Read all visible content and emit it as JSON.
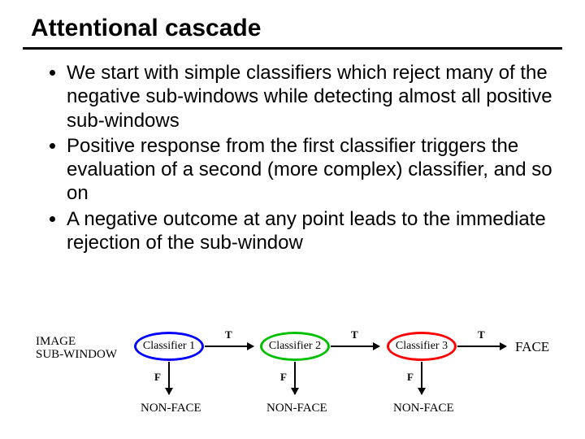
{
  "title": "Attentional cascade",
  "bullets": [
    "We start with simple classifiers which reject many of the negative sub-windows while detecting almost all positive sub-windows",
    "Positive response from the first classifier triggers the evaluation of a second (more complex) classifier, and so on",
    "A negative outcome at any point leads to the immediate rejection of the sub-window"
  ],
  "diagram": {
    "input_line1": "IMAGE",
    "input_line2": "SUB-WINDOW",
    "nodes": [
      "Classifier 1",
      "Classifier 2",
      "Classifier 3"
    ],
    "true_label": "T",
    "false_label": "F",
    "reject_label": "NON-FACE",
    "output_label": "FACE",
    "colors": [
      "#0000ff",
      "#00c000",
      "#ff0000"
    ]
  }
}
